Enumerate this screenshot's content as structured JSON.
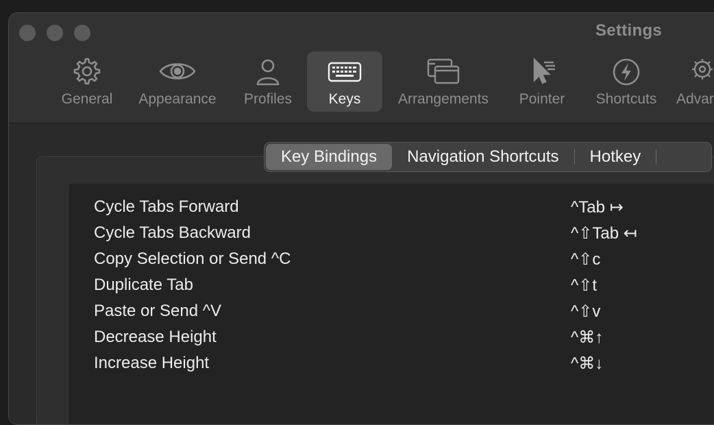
{
  "window": {
    "title": "Settings"
  },
  "toolbar": {
    "items": [
      {
        "label": "General",
        "icon": "gear-icon"
      },
      {
        "label": "Appearance",
        "icon": "eye-icon"
      },
      {
        "label": "Profiles",
        "icon": "person-icon"
      },
      {
        "label": "Keys",
        "icon": "keyboard-icon",
        "selected": true
      },
      {
        "label": "Arrangements",
        "icon": "windows-icon"
      },
      {
        "label": "Pointer",
        "icon": "pointer-icon"
      },
      {
        "label": "Shortcuts",
        "icon": "bolt-icon"
      },
      {
        "label": "Advanced",
        "icon": "gears-icon"
      }
    ]
  },
  "tabs": {
    "items": [
      {
        "label": "Key Bindings",
        "selected": true
      },
      {
        "label": "Navigation Shortcuts"
      },
      {
        "label": "Hotkey"
      }
    ]
  },
  "bindings": [
    {
      "action": "Cycle Tabs Forward",
      "shortcut": "^Tab ↦"
    },
    {
      "action": "Cycle Tabs Backward",
      "shortcut": "^⇧Tab ↤"
    },
    {
      "action": "Copy Selection or Send ^C",
      "shortcut": "^⇧c"
    },
    {
      "action": "Duplicate Tab",
      "shortcut": "^⇧t"
    },
    {
      "action": "Paste or Send ^V",
      "shortcut": "^⇧v"
    },
    {
      "action": "Decrease Height",
      "shortcut": "^⌘↑"
    },
    {
      "action": "Increase Height",
      "shortcut": "^⌘↓"
    }
  ],
  "colors": {
    "window_bg": "#2a2a2a",
    "toolbar_bg": "#323232",
    "selected_bg": "#484848",
    "list_bg": "#232323",
    "text": "#ececec",
    "muted": "#8e8e8e"
  }
}
